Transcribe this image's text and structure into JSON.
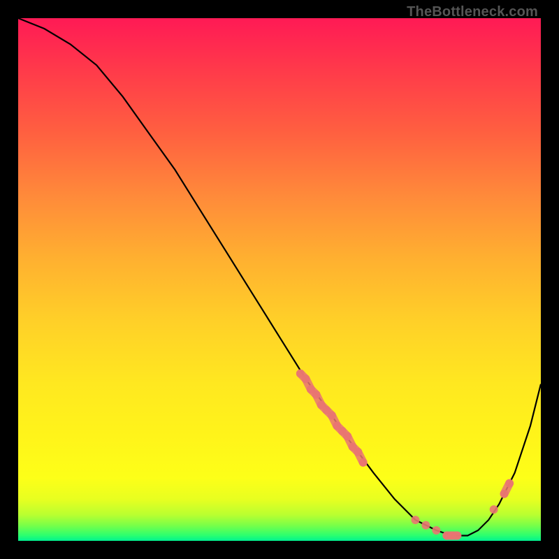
{
  "watermark": "TheBottleneck.com",
  "chart_data": {
    "type": "line",
    "title": "",
    "xlabel": "",
    "ylabel": "",
    "xlim": [
      0,
      100
    ],
    "ylim": [
      0,
      100
    ],
    "grid": false,
    "legend": false,
    "series": [
      {
        "name": "curve",
        "x": [
          0,
          5,
          10,
          15,
          20,
          25,
          30,
          35,
          40,
          45,
          50,
          55,
          60,
          62,
          65,
          68,
          72,
          76,
          80,
          83,
          86,
          88,
          90,
          92,
          95,
          98,
          100
        ],
        "y": [
          100,
          98,
          95,
          91,
          85,
          78,
          71,
          63,
          55,
          47,
          39,
          31,
          24,
          21,
          17,
          13,
          8,
          4,
          2,
          1,
          1,
          2,
          4,
          7,
          13,
          22,
          30
        ]
      }
    ],
    "highlight_points": {
      "name": "datapoints",
      "x": [
        54,
        55,
        56,
        57,
        58,
        59,
        60,
        61,
        62,
        63,
        64,
        65,
        66,
        76,
        78,
        80,
        82,
        83,
        84,
        91,
        93,
        94
      ],
      "y": [
        32,
        31,
        29,
        28,
        26,
        25,
        24,
        22,
        21,
        20,
        18,
        17,
        15,
        4,
        3,
        2,
        1,
        1,
        1,
        6,
        9,
        11
      ]
    }
  }
}
